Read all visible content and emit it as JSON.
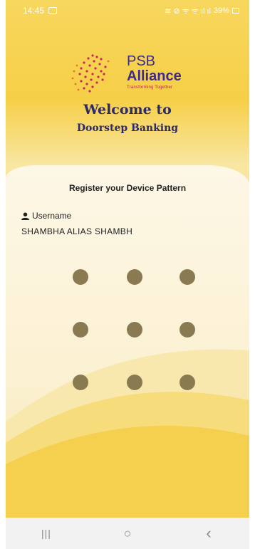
{
  "status_bar": {
    "time": "14:45",
    "indicators": "≋ ⊘ ᯤ ᯤ ıl ıl",
    "battery": "39%"
  },
  "logo": {
    "brand_line1": "PSB",
    "brand_line2": "Alliance",
    "tagline": "Transforming Together"
  },
  "header": {
    "welcome": "Welcome to",
    "subtitle": "Doorstep Banking"
  },
  "card": {
    "title": "Register your Device Pattern",
    "username_label": "Username",
    "username_value": "SHAMBHA ALIAS SHAMBH"
  },
  "pattern": {
    "rows": 3,
    "cols": 3
  },
  "nav": {
    "recent_glyph": "|||",
    "home_glyph": "○",
    "back_glyph": "‹"
  },
  "colors": {
    "background": "#f6cf47",
    "brand": "#3b2a8f",
    "dot": "#8a7a52"
  }
}
